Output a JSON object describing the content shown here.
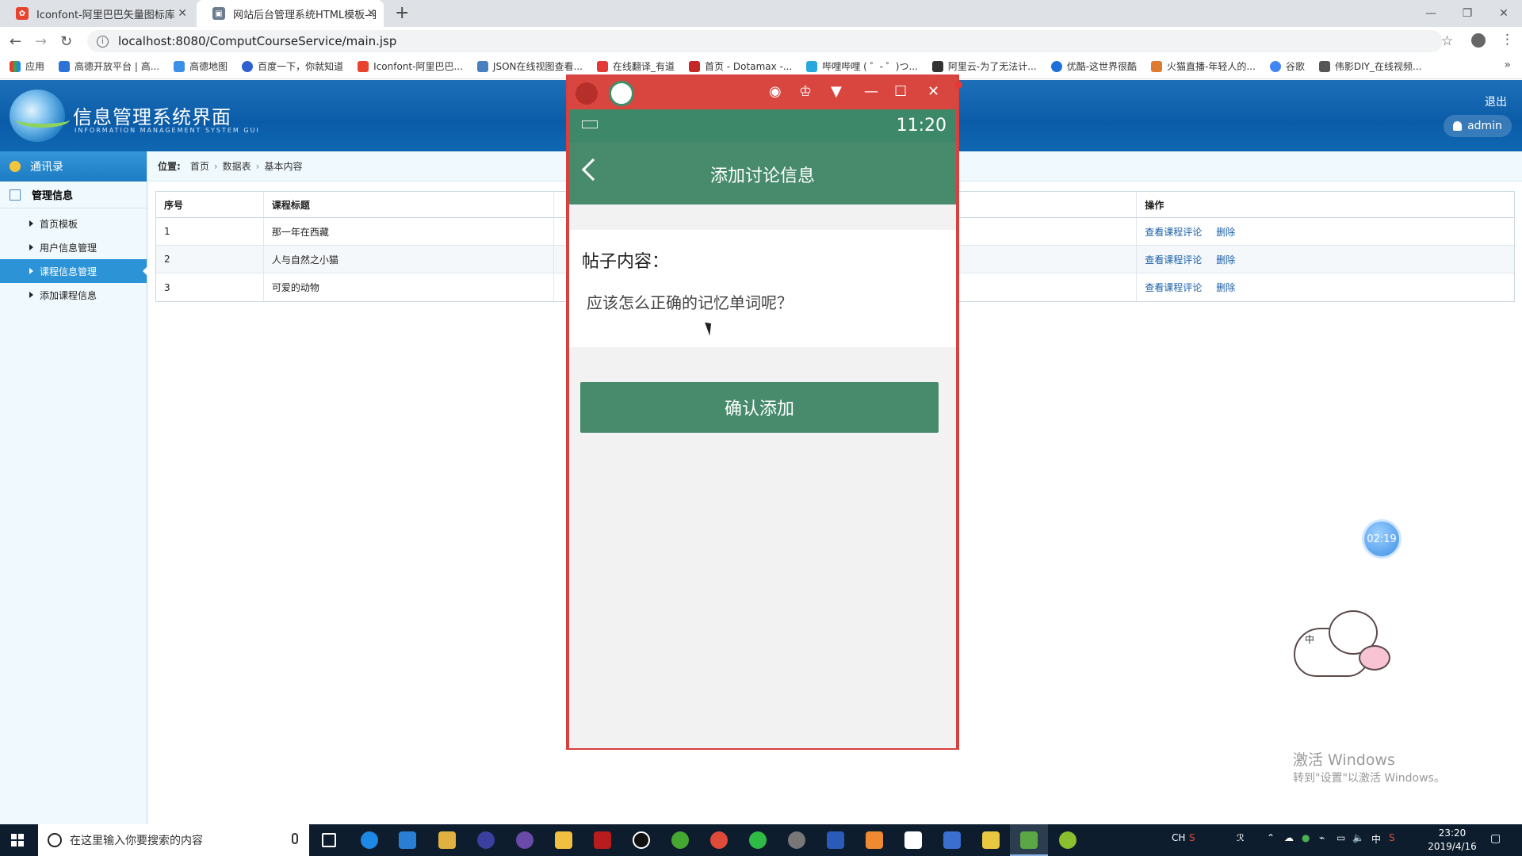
{
  "browser": {
    "tabs": [
      {
        "title": "Iconfont-阿里巴巴矢量图标库",
        "active": false
      },
      {
        "title": "网站后台管理系统HTML模板--我",
        "active": true
      }
    ],
    "url": "localhost:8080/ComputCourseService/main.jsp",
    "bookmarks": [
      "应用",
      "高德开放平台 | 高...",
      "高德地图",
      "百度一下，你就知道",
      "Iconfont-阿里巴巴...",
      "JSON在线视图查看...",
      "在线翻译_有道",
      "首页 - Dotamax -...",
      "哔哩哔哩 ( ゜- ゜)つ...",
      "阿里云-为了无法计...",
      "优酷-这世界很酷",
      "火猫直播-年轻人的...",
      "谷歌",
      "伟影DIY_在线视频..."
    ]
  },
  "header": {
    "title": "信息管理系统界面",
    "subtitle": "INFORMATION MANAGEMENT SYSTEM GUI",
    "logout": "退出",
    "user": "admin"
  },
  "sidebar": {
    "head": "通讯录",
    "group": "管理信息",
    "items": [
      {
        "label": "首页模板",
        "active": false
      },
      {
        "label": "用户信息管理",
        "active": false
      },
      {
        "label": "课程信息管理",
        "active": true
      },
      {
        "label": "添加课程信息",
        "active": false
      }
    ]
  },
  "breadcrumb": {
    "prefix": "位置:",
    "items": [
      "首页",
      "数据表",
      "基本内容"
    ]
  },
  "table": {
    "headers": [
      "序号",
      "课程标题",
      "",
      "操作"
    ],
    "rows": [
      {
        "id": "1",
        "title": "那一年在西藏",
        "view": "查看课程评论",
        "delete": "删除"
      },
      {
        "id": "2",
        "title": "人与自然之小猫",
        "view": "查看课程评论",
        "delete": "删除"
      },
      {
        "id": "3",
        "title": "可爱的动物",
        "view": "查看课程评论",
        "delete": "删除"
      }
    ]
  },
  "emulator": {
    "status_time": "11:20",
    "toolbar_title": "添加讨论信息",
    "form_label": "帖子内容：",
    "input_value": "应该怎么正确的记忆单词呢？",
    "confirm": "确认添加"
  },
  "floating": {
    "timer": "02:19",
    "mascot_text": "中"
  },
  "watermark": {
    "line1": "激活 Windows",
    "line2": "转到\"设置\"以激活 Windows。"
  },
  "taskbar": {
    "search_placeholder": "在这里输入你要搜索的内容",
    "tray_lang": "CH",
    "ime": "中",
    "time": "23:20",
    "date": "2019/4/16"
  },
  "colors": {
    "accent": "#478b6c",
    "header": "#0b5ca8",
    "emulator_frame": "#d9463f",
    "sidebar_active": "#2b93d6"
  }
}
